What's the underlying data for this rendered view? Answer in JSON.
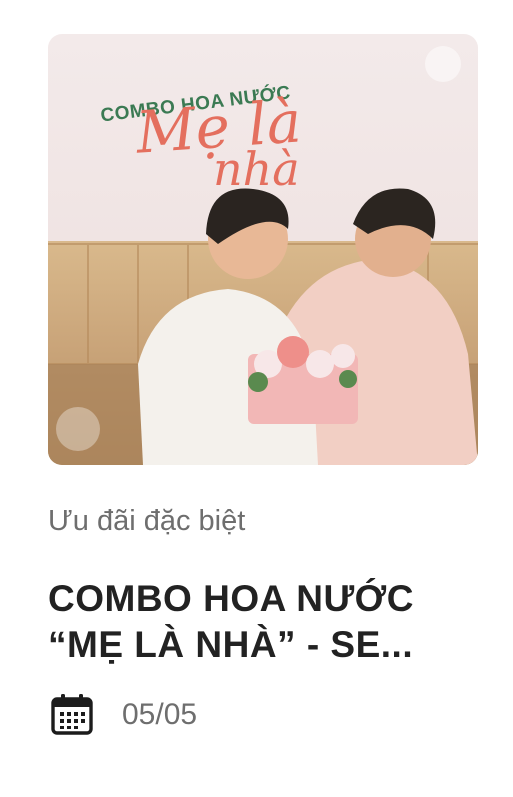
{
  "promo": {
    "image_text": {
      "line1": "COMBO HOA NƯỚC",
      "line2": "Mẹ là",
      "line3": "nhà"
    },
    "category": "Ưu đãi đặc biệt",
    "title_line1": "COMBO HOA NƯỚC",
    "title_line2": "“MẸ LÀ NHÀ” - SE...",
    "date": "05/05",
    "icons": {
      "date": "calendar-icon"
    },
    "colors": {
      "image_green_text": "#3b7a53",
      "image_script_text": "#e46f5e",
      "meta_text": "#6e6e6e",
      "title_text": "#222222"
    }
  }
}
